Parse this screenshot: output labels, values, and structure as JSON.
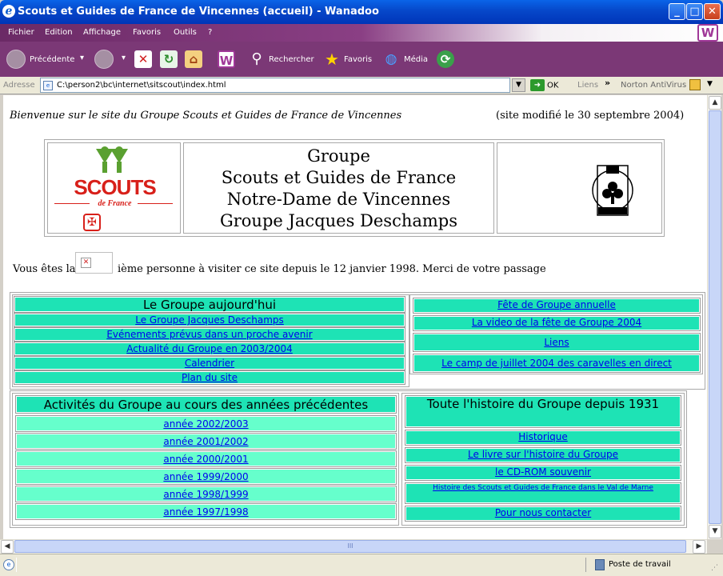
{
  "window": {
    "title": "Scouts et Guides de France de Vincennes (accueil) - Wanadoo",
    "min": "_",
    "max": "□",
    "close": "✕"
  },
  "menu": {
    "items": [
      "Fichier",
      "Edition",
      "Affichage",
      "Favoris",
      "Outils",
      "?"
    ],
    "brand": "W"
  },
  "toolbar": {
    "back": "Précédente",
    "search": "Rechercher",
    "favorites": "Favoris",
    "media": "Média",
    "brand": "W"
  },
  "address": {
    "label": "Adresse",
    "value": "C:\\person2\\bc\\internet\\sitscout\\index.html",
    "go": "OK",
    "links": "Liens",
    "norton": "Norton AntiVirus"
  },
  "page": {
    "welcome": "Bienvenue sur le site du Groupe Scouts et Guides de France de Vincennes",
    "modified": "(site modifié le 30 septembre 2004)",
    "logo_text": "SCOUTS",
    "logo_sub": "de France",
    "banner": [
      "Groupe",
      "Scouts et Guides de France",
      "Notre-Dame de Vincennes",
      "Groupe Jacques Deschamps"
    ],
    "visitor_prefix": "Vous êtes la",
    "visitor_suffix": "ième personne à visiter ce site depuis le 12 janvier 1998. Merci de votre passage",
    "today": {
      "title": "Le Groupe aujourd'hui",
      "links": [
        "Le Groupe Jacques Deschamps",
        "Evénements prévus dans un proche avenir",
        "Actualité du Groupe en 2003/2004",
        "Calendrier",
        "Plan du site"
      ]
    },
    "events": {
      "links": [
        "Fête de Groupe annuelle",
        "La video de la fête de Groupe 2004",
        "Liens",
        "Le camp de juillet 2004 des caravelles en direct"
      ]
    },
    "past": {
      "title": "Activités du Groupe au cours des années précédentes",
      "links": [
        "année 2002/2003",
        "année 2001/2002",
        "année 2000/2001",
        "année 1999/2000",
        "année 1998/1999",
        "année 1997/1998"
      ]
    },
    "history": {
      "title": "Toute l'histoire du Groupe depuis 1931",
      "links": [
        "Historique",
        "Le livre sur l'histoire du Groupe",
        "le CD-ROM souvenir",
        "Histoire des Scouts et Guides de France  dans le Val de Marne",
        "Pour nous contacter"
      ]
    }
  },
  "status": {
    "zone": "Poste de travail",
    "scroll_grip": "III"
  }
}
